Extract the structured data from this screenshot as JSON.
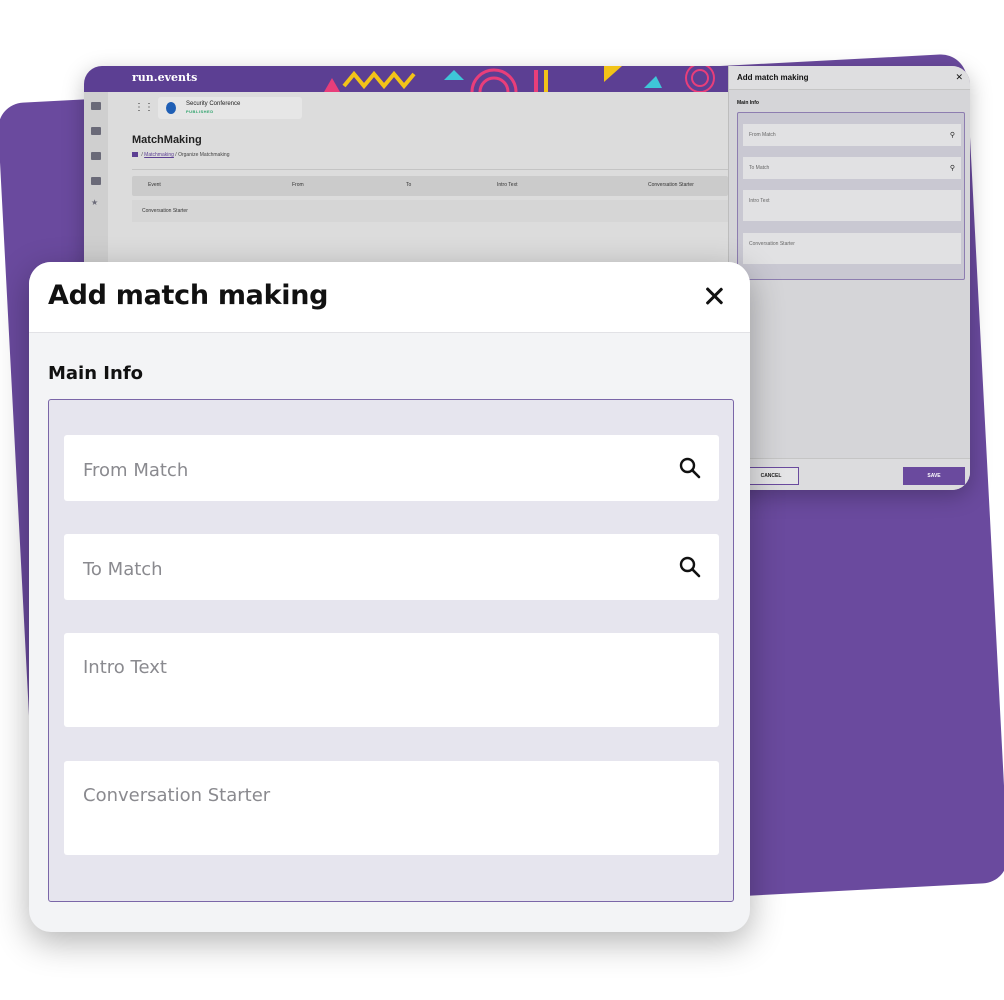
{
  "background_app": {
    "brand": "run.events",
    "event_card": {
      "name": "Security Conference",
      "status": "PUBLISHED"
    },
    "page_title": "MatchMaking",
    "breadcrumb": {
      "link": "Matchmaking",
      "separator": " / ",
      "current": "Organize Matchmaking"
    },
    "table": {
      "columns": [
        "Event",
        "From",
        "To",
        "Intro Text",
        "Conversation Starter"
      ],
      "rows": [
        [
          "Conversation Starter"
        ]
      ]
    },
    "sidebar_icons": [
      "chat-icon",
      "image-icon",
      "folder-icon",
      "clipboard-icon",
      "star-icon"
    ]
  },
  "side_panel": {
    "title": "Add match making",
    "close_icon": "close-icon",
    "section_title": "Main Info",
    "fields": {
      "from_match": "From Match",
      "to_match": "To Match",
      "intro_text": "Intro Text",
      "conversation_starter": "Conversation Starter"
    },
    "cancel_label": "CANCEL",
    "save_label": "SAVE"
  },
  "modal": {
    "title": "Add match making",
    "close_icon": "close-icon",
    "section_title": "Main Info",
    "fields": {
      "from_match": "From Match",
      "to_match": "To Match",
      "intro_text": "Intro Text",
      "conversation_starter": "Conversation Starter"
    },
    "search_icon": "search-icon"
  },
  "colors": {
    "brand_purple": "#6a4a9e",
    "header_purple": "#5c3f93",
    "box_border": "#7a66a8",
    "published_green": "#2ca26a"
  }
}
